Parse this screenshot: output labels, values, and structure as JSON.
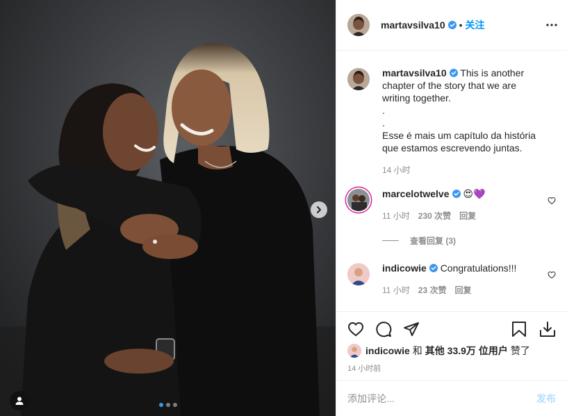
{
  "post": {
    "author": "martavsilva10",
    "follow_label": "关注",
    "separator": "•",
    "caption": "This is another chapter of the story that we are writing together.\n.\n.\nEsse é mais um capítulo da história que estamos escrevendo juntas.",
    "caption_time": "14 小时"
  },
  "comments": [
    {
      "user": "marcelotwelve",
      "emoji": "😍💜",
      "time": "11 小时",
      "likes": "230 次赞",
      "reply_label": "回复",
      "view_replies": "查看回复 (3)"
    },
    {
      "user": "indicowie",
      "text": "Congratulations!!!",
      "time": "11 小时",
      "likes": "23 次赞",
      "reply_label": "回复"
    }
  ],
  "likes_line": {
    "user": "indicowie",
    "and": "和",
    "others": "其他 33.9万 位用户",
    "suffix": "赞了"
  },
  "post_time": "14 小时前",
  "composer": {
    "placeholder": "添加评论...",
    "post_label": "发布"
  },
  "carousel": {
    "slide_count": 3,
    "active_index": 0
  },
  "colors": {
    "link_blue": "#0095f6",
    "verified_blue": "#3897f0",
    "muted_gray": "#8e8e8e",
    "post_button_disabled": "#b2dffc"
  },
  "icons": [
    "verified-badge-icon",
    "more-options-icon",
    "heart-icon",
    "comment-icon",
    "share-icon",
    "bookmark-icon",
    "download-icon",
    "chevron-right-icon",
    "user-tag-icon"
  ]
}
